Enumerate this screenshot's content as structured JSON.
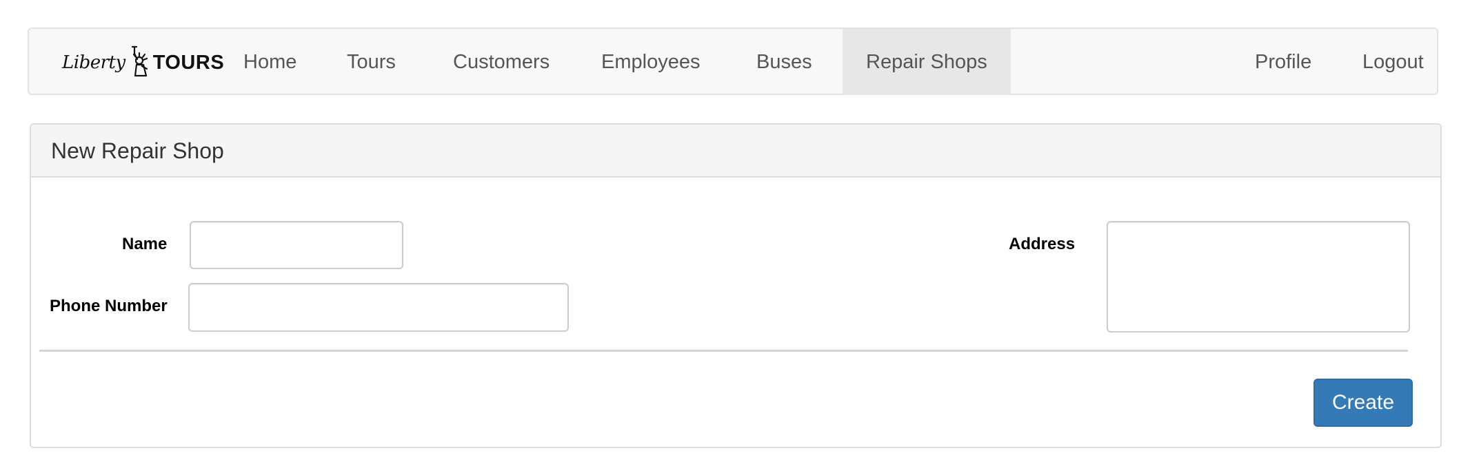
{
  "navbar": {
    "brand": {
      "script_text": "Liberty",
      "bold_text": "TOURS",
      "icon": "statue-of-liberty-icon"
    },
    "items": [
      {
        "label": "Home"
      },
      {
        "label": "Tours"
      },
      {
        "label": "Customers"
      },
      {
        "label": "Employees"
      },
      {
        "label": "Buses"
      },
      {
        "label": "Repair Shops",
        "active": true
      }
    ],
    "right_items": [
      {
        "label": "Profile"
      },
      {
        "label": "Logout"
      }
    ]
  },
  "form": {
    "title": "New Repair Shop",
    "fields": {
      "name": {
        "label": "Name",
        "value": ""
      },
      "phone": {
        "label": "Phone Number",
        "value": ""
      },
      "address": {
        "label": "Address",
        "value": ""
      }
    },
    "submit_label": "Create"
  },
  "colors": {
    "primary_button": "#337ab7",
    "navbar_background": "#f8f8f8",
    "active_nav_background": "#e7e7e7"
  }
}
